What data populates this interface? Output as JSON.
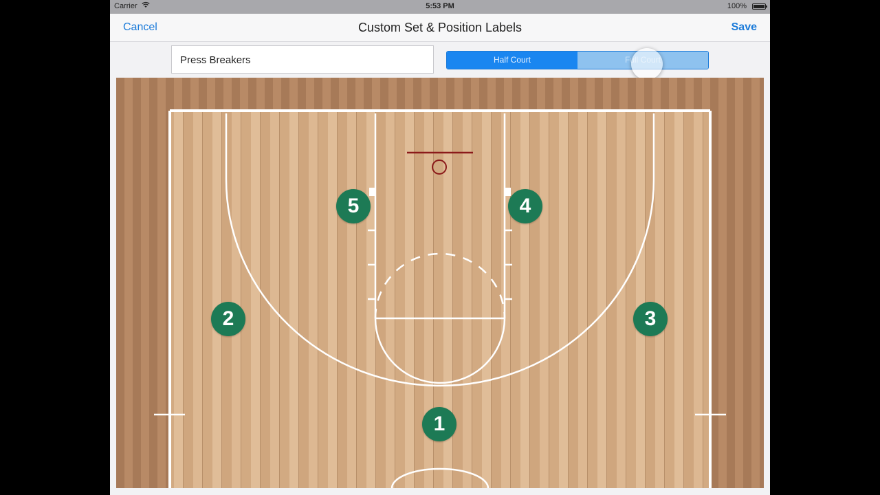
{
  "status_bar": {
    "carrier": "Carrier",
    "time": "5:53 PM",
    "battery": "100%"
  },
  "nav": {
    "cancel_label": "Cancel",
    "title": "Custom Set & Position Labels",
    "save_label": "Save"
  },
  "set_name": {
    "value": "Press Breakers"
  },
  "court_toggle": {
    "options": [
      "Half Court",
      "Full Court"
    ],
    "selected": "Half Court"
  },
  "players": [
    {
      "label": "1"
    },
    {
      "label": "2"
    },
    {
      "label": "3"
    },
    {
      "label": "4"
    },
    {
      "label": "5"
    }
  ],
  "colors": {
    "accent": "#1a7ad9",
    "player_marker": "#1d7a55",
    "rim": "#8b1a1a",
    "court_lines": "#ffffff"
  }
}
